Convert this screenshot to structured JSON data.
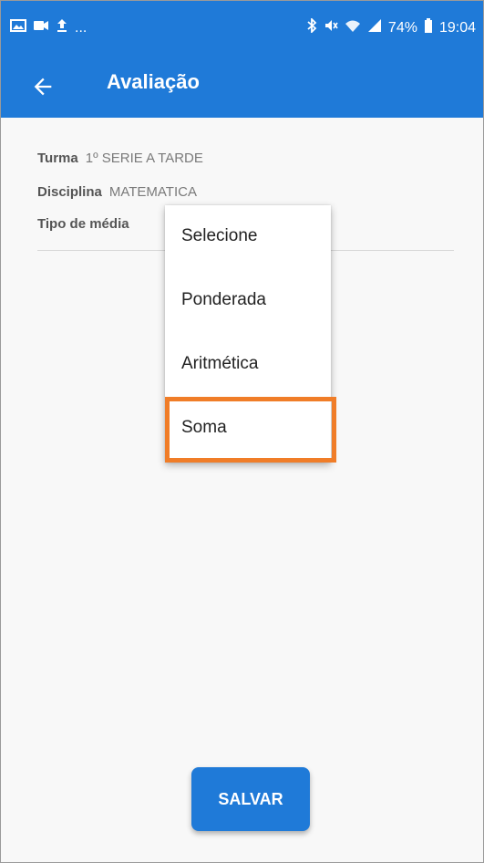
{
  "status_bar": {
    "notification_more": "...",
    "battery_percent": "74%",
    "time": "19:04"
  },
  "app_bar": {
    "back_icon": "arrow-left-icon",
    "title": "Avaliação"
  },
  "form": {
    "turma_label": "Turma",
    "turma_value": "1º SERIE A TARDE",
    "disciplina_label": "Disciplina",
    "disciplina_value": "MATEMATICA",
    "tipo_media_label": "Tipo de média"
  },
  "dropdown": {
    "options": [
      {
        "label": "Selecione"
      },
      {
        "label": "Ponderada"
      },
      {
        "label": "Aritmética"
      },
      {
        "label": "Soma"
      }
    ],
    "highlighted_option": "Soma"
  },
  "actions": {
    "save_label": "SALVAR"
  },
  "colors": {
    "primary": "#1f7ad8",
    "highlight": "#f07d28"
  }
}
